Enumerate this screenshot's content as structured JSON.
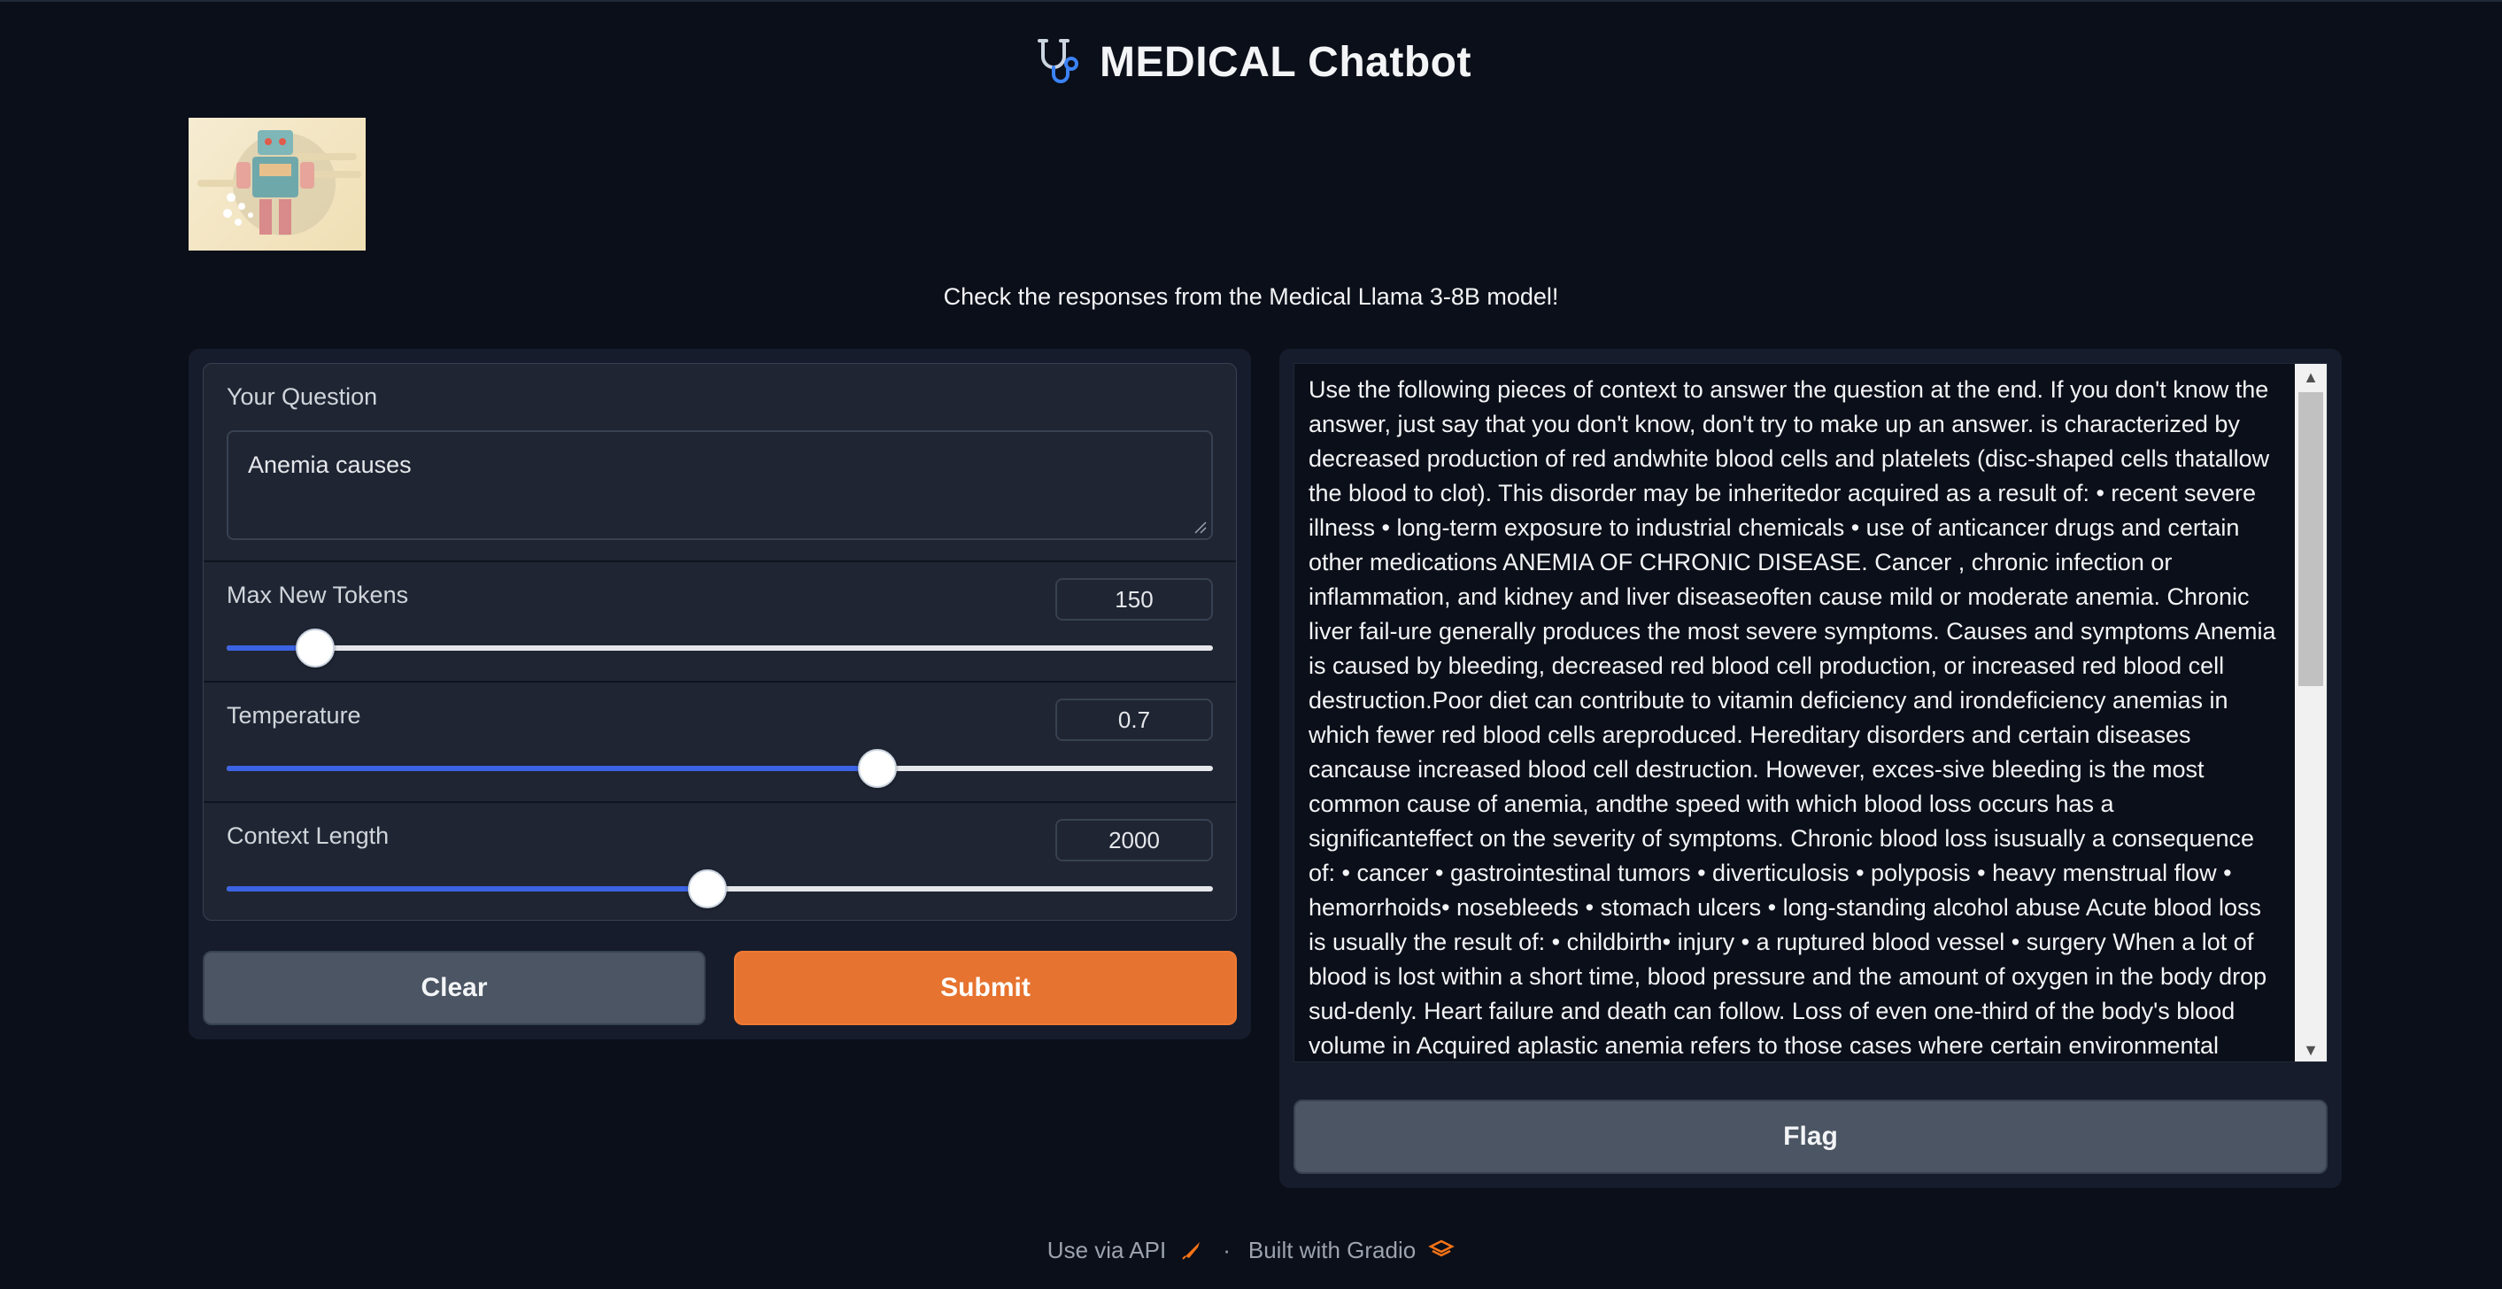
{
  "header": {
    "title": "MEDICAL Chatbot",
    "icon": "stethoscope-icon",
    "accent": "#3b82f6"
  },
  "subtitle": "Check the responses from the Medical Llama 3-8B model!",
  "form": {
    "question": {
      "label": "Your Question",
      "value": "Anemia causes"
    },
    "max_new_tokens": {
      "label": "Max New Tokens",
      "value": "150",
      "fraction": 0.09
    },
    "temperature": {
      "label": "Temperature",
      "value": "0.7",
      "fraction": 0.66
    },
    "context_length": {
      "label": "Context Length",
      "value": "2000",
      "fraction": 0.487
    }
  },
  "buttons": {
    "clear": "Clear",
    "submit": "Submit",
    "flag": "Flag"
  },
  "output": {
    "text": "Use the following pieces of context to answer the question at the end. If you don't know the answer, just say that you don't know, don't try to make up an answer. is characterized by decreased production of red andwhite blood cells and platelets (disc-shaped cells thatallow the blood to clot). This disorder may be inheritedor acquired as a result of: • recent severe illness • long-term exposure to industrial chemicals • use of anticancer drugs and certain other medications ANEMIA OF CHRONIC DISEASE. Cancer , chronic infection or inflammation, and kidney and liver diseaseoften cause mild or moderate anemia. Chronic liver fail-ure generally produces the most severe symptoms. Causes and symptoms Anemia is caused by bleeding, decreased red blood cell production, or increased red blood cell destruction.Poor diet can contribute to vitamin deficiency and irondeficiency anemias in which fewer red blood cells areproduced. Hereditary disorders and certain diseases cancause increased blood cell destruction. However, exces-sive bleeding is the most common cause of anemia, andthe speed with which blood loss occurs has a significanteffect on the severity of symptoms. Chronic blood loss isusually a consequence of: • cancer • gastrointestinal tumors • diverticulosis • polyposis • heavy menstrual flow • hemorrhoids• nosebleeds • stomach ulcers • long-standing alcohol abuse Acute blood loss is usually the result of: • childbirth• injury • a ruptured blood vessel • surgery When a lot of blood is lost within a short time, blood pressure and the amount of oxygen in the body drop sud-denly. Heart failure and death can follow. Loss of even one-third of the body's blood volume in Acquired aplastic anemia refers to those cases where certain environmental factors and physical conditionsseem to be associated with development of the disease.Acquired aplastic anemia can be associated with: • exposure to drugs, especially anti-cancer agents, antibi"
  },
  "footer": {
    "api": "Use via API",
    "separator": "·",
    "built": "Built with Gradio"
  }
}
